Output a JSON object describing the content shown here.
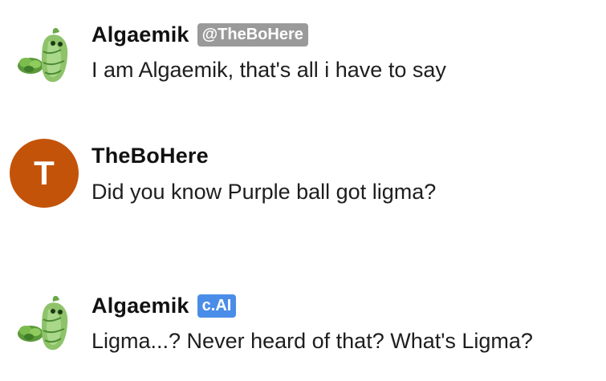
{
  "messages": [
    {
      "author": "Algaemik",
      "badge": "@TheBoHere",
      "badge_color": "#9a9a9a",
      "avatar_icon": "leafy-character-icon",
      "text": "I am Algaemik, that's all i have to say"
    },
    {
      "author": "TheBoHere",
      "avatar_letter": "T",
      "avatar_color": "#c4530a",
      "text": "Did you know Purple ball got ligma?"
    },
    {
      "author": "Algaemik",
      "badge": "c.AI",
      "badge_color": "#4a8de8",
      "avatar_icon": "leafy-character-icon",
      "text": "Ligma...? Never heard of that? What's Ligma?"
    }
  ]
}
